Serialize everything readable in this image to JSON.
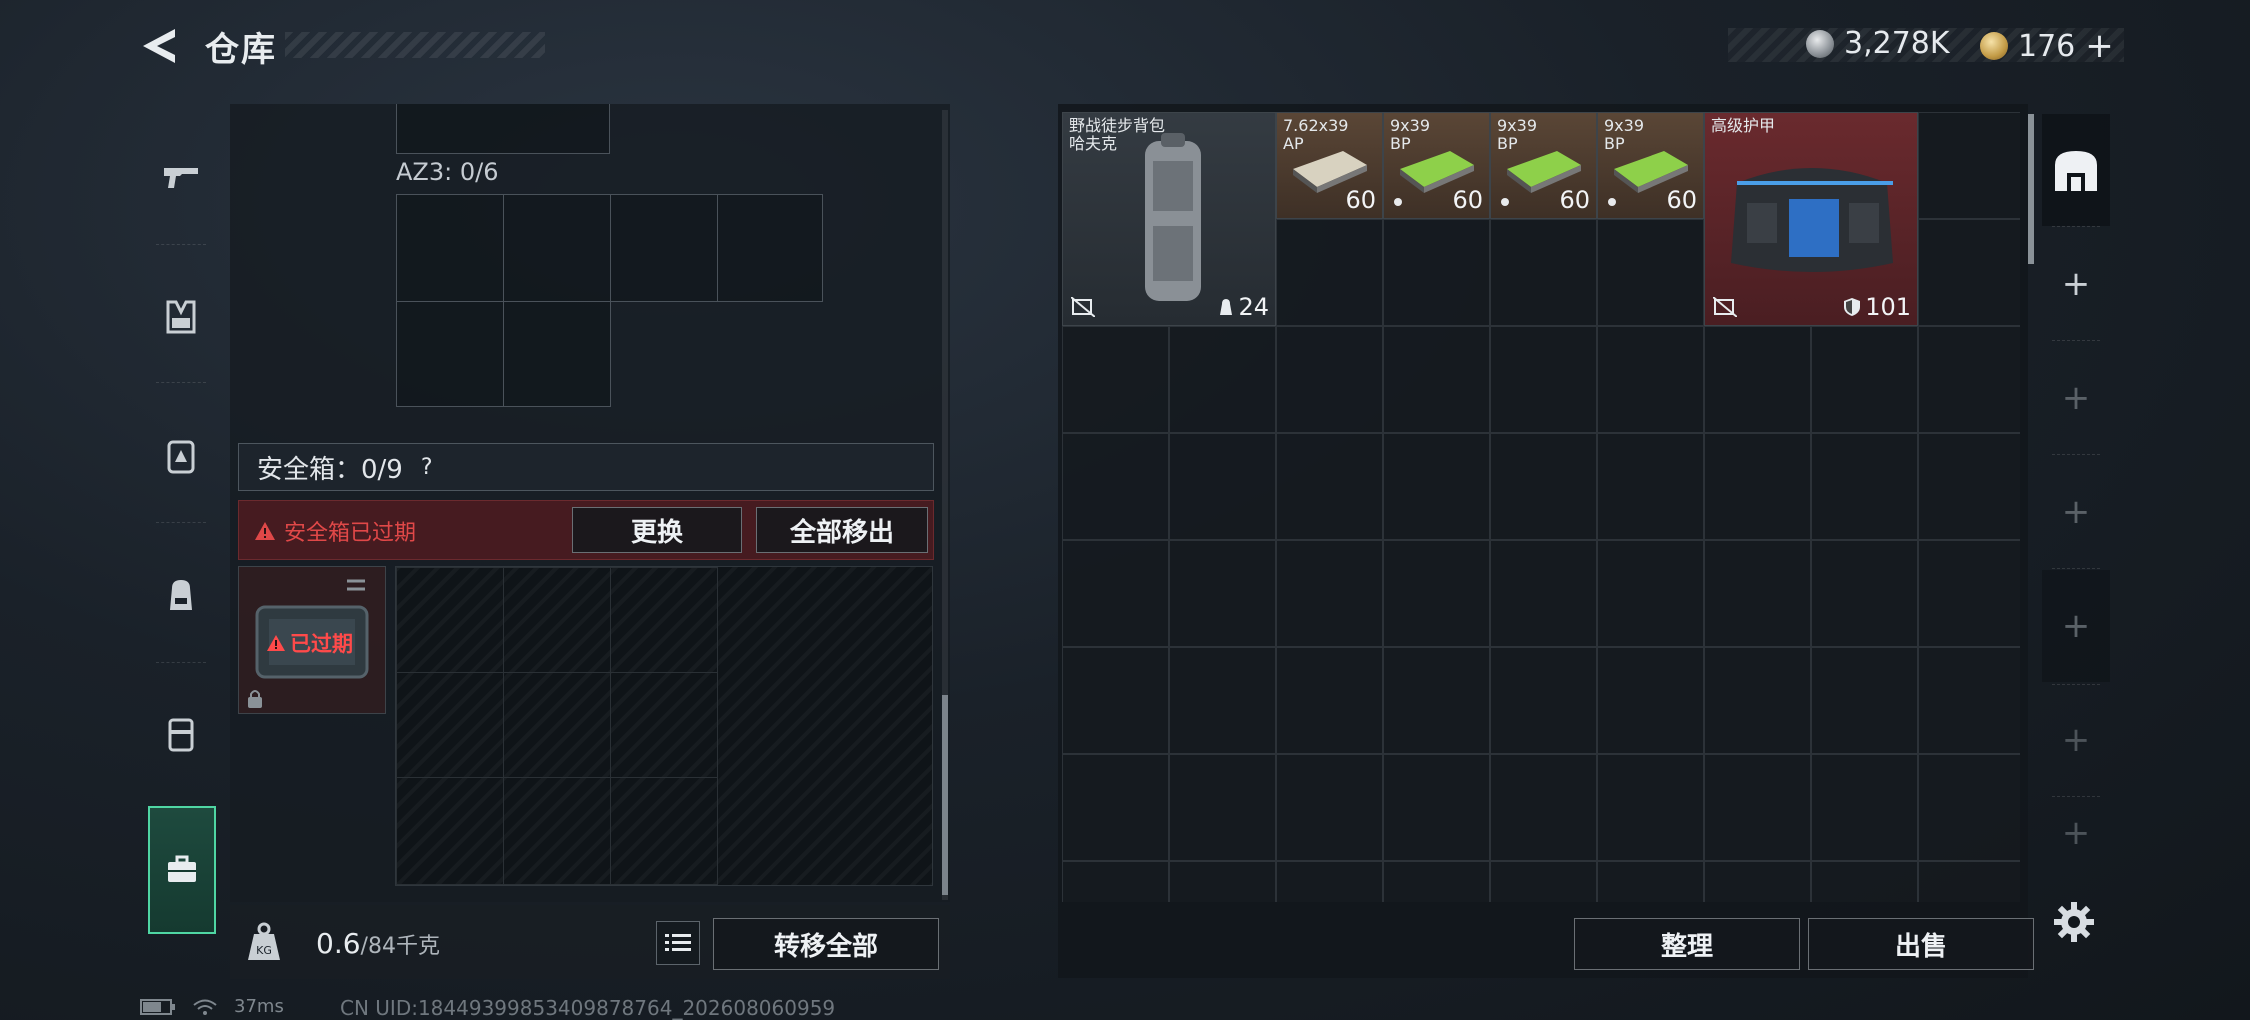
{
  "header": {
    "title": "仓库",
    "currency": [
      {
        "icon": "silver-coin-icon",
        "value": "3,278K"
      },
      {
        "icon": "gold-coin-icon",
        "value": "176"
      }
    ],
    "plus_label": "+"
  },
  "sidebar": {
    "items": [
      {
        "icon": "pistol-icon"
      },
      {
        "icon": "chest-rig-icon"
      },
      {
        "icon": "armor-vest-icon"
      },
      {
        "icon": "backpack-icon"
      },
      {
        "icon": "container-icon"
      },
      {
        "icon": "safebox-briefcase-icon",
        "active": true
      }
    ]
  },
  "left": {
    "az3_label": "AZ3: 0/6",
    "safebox_label": "安全箱：0/9",
    "help_label": "?",
    "expired_warning": "安全箱已过期",
    "replace_button": "更换",
    "move_all_out_button": "全部移出",
    "expired_tag": "已过期",
    "weight_value": "0.6",
    "weight_total": "/84千克",
    "transfer_all_button": "转移全部"
  },
  "inventory": {
    "items": [
      {
        "name_line1": "野战徒步背包",
        "name_line2": "哈夫克",
        "qty": "24",
        "kind": "backpack"
      },
      {
        "name_line1": "7.62x39",
        "name_line2": "AP",
        "qty": "60",
        "kind": "ammo-brown"
      },
      {
        "name_line1": "9x39",
        "name_line2": "BP",
        "qty": "60",
        "kind": "ammo-green"
      },
      {
        "name_line1": "9x39",
        "name_line2": "BP",
        "qty": "60",
        "kind": "ammo-green"
      },
      {
        "name_line1": "9x39",
        "name_line2": "BP",
        "qty": "60",
        "kind": "ammo-green"
      },
      {
        "name_line1": "高级护甲",
        "name_line2": "",
        "qty": "101",
        "kind": "armor"
      }
    ],
    "organize_button": "整理",
    "sell_button": "出售"
  },
  "right_rail": {
    "plus_label": "+"
  },
  "status": {
    "ping": "37ms",
    "uid": "CN UID:18449399853409878764_202608060959"
  },
  "colors": {
    "accent_green": "#4fd6a3",
    "warning_red": "#e04848",
    "armor_bg": "#6a2a2e",
    "ammo_bg": "#5a4636"
  }
}
